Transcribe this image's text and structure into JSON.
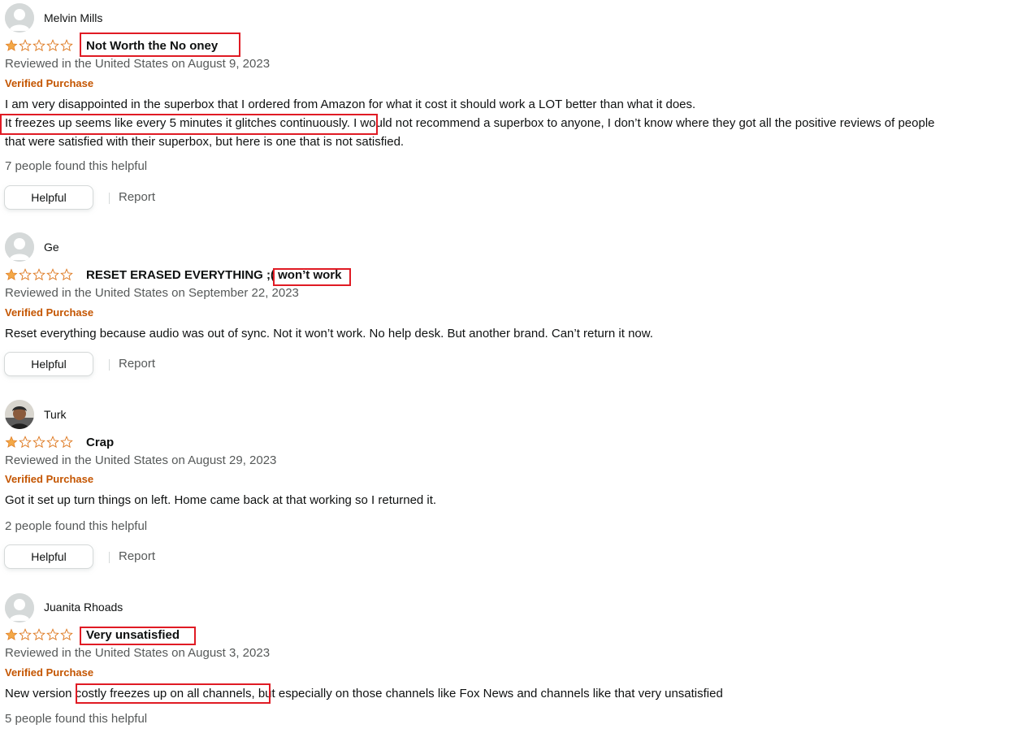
{
  "reviews": [
    {
      "reviewer": "Melvin Mills",
      "rating": 1,
      "title": "Not Worth the No oney",
      "date": "Reviewed in the United States on August 9, 2023",
      "verified": "Verified Purchase",
      "body_lines": [
        "I am very disappointed in the superbox that I ordered from Amazon for what it cost it should work a LOT better than what it does.",
        "It freezes up seems like every 5 minutes it glitches continuously.",
        " I would not recommend a superbox to anyone, I don’t know where they got all the positive reviews of people",
        "that were satisfied with their superbox, but here is one that is not satisfied."
      ],
      "helpful_count": "7 people found this helpful",
      "helpful_label": "Helpful",
      "report_label": "Report"
    },
    {
      "reviewer": "Ge",
      "rating": 1,
      "title": "RESET ERASED EVERYTHING ;( ",
      "title_highlight": "won’t work",
      "date": "Reviewed in the United States on September 22, 2023",
      "verified": "Verified Purchase",
      "body_lines": [
        "Reset everything because audio was out of sync. Not it won’t work. No help desk. But another brand. Can’t return it now."
      ],
      "helpful_label": "Helpful",
      "report_label": "Report"
    },
    {
      "reviewer": "Turk",
      "rating": 1,
      "title": "Crap",
      "date": "Reviewed in the United States on August 29, 2023",
      "verified": "Verified Purchase",
      "body_lines": [
        "Got it set up turn things on left. Home came back at that working so I returned it."
      ],
      "helpful_count": "2 people found this helpful",
      "helpful_label": "Helpful",
      "report_label": "Report"
    },
    {
      "reviewer": "Juanita Rhoads",
      "rating": 1,
      "title": "Very unsatisfied",
      "date": "Reviewed in the United States on August 3, 2023",
      "verified": "Verified Purchase",
      "body_parts": [
        "New version ",
        "costly freezes up on all channels,",
        " but especially on those channels like Fox News and channels like that very unsatisfied"
      ],
      "helpful_count": "5 people found this helpful"
    }
  ],
  "colors": {
    "star": "#f3a847",
    "verified": "#c45500",
    "highlight_box": "#e01b24"
  },
  "icons": {
    "avatar": "default-avatar-icon",
    "star_filled": "star-filled-icon",
    "star_empty": "star-empty-icon"
  }
}
